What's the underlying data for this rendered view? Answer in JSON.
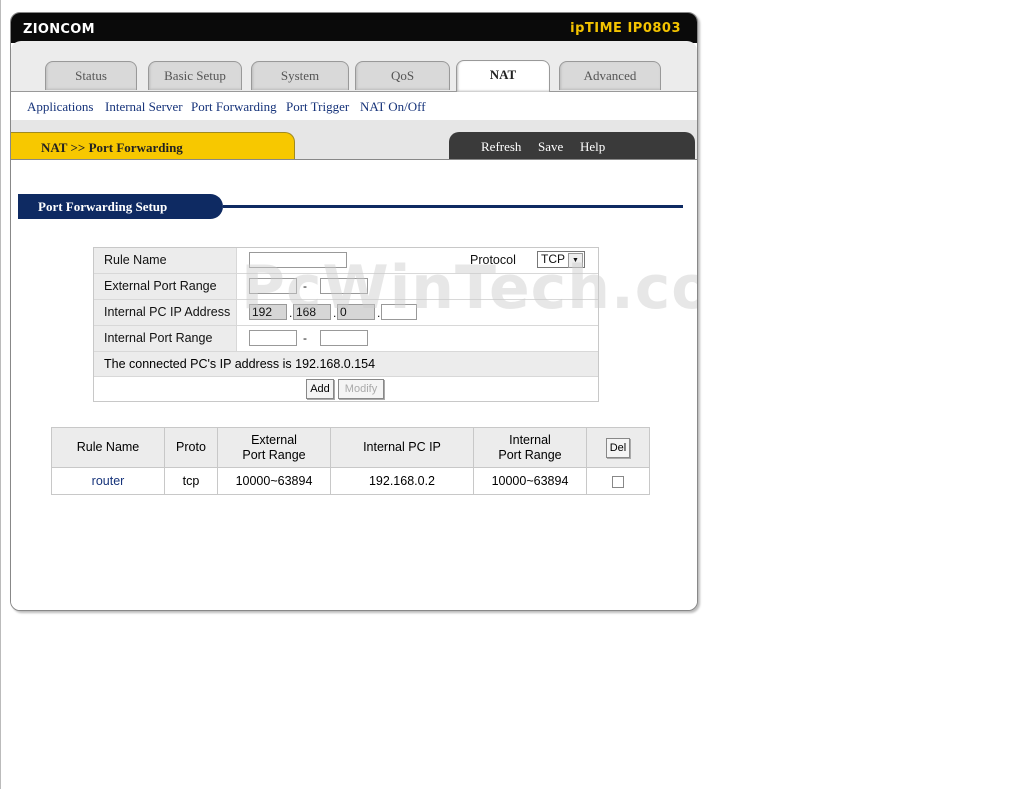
{
  "header": {
    "brand": "ZIONCOM",
    "model": "ipTIME IP0803"
  },
  "tabs": [
    {
      "label": "Status"
    },
    {
      "label": "Basic Setup"
    },
    {
      "label": "System"
    },
    {
      "label": "QoS"
    },
    {
      "label": "NAT",
      "active": true
    },
    {
      "label": "Advanced"
    }
  ],
  "subnav": [
    "Applications",
    "Internal Server",
    "Port Forwarding",
    "Port Trigger",
    "NAT On/Off"
  ],
  "breadcrumb": "NAT >> Port Forwarding",
  "actions": {
    "refresh": "Refresh",
    "save": "Save",
    "help": "Help"
  },
  "section_title": "Port Forwarding Setup",
  "form": {
    "rule_name_label": "Rule Name",
    "rule_name_value": "",
    "protocol_label": "Protocol",
    "protocol_value": "TCP",
    "external_port_label": "External Port Range",
    "external_port_from": "",
    "external_port_to": "",
    "internal_ip_label": "Internal PC IP Address",
    "ip_octets": [
      "192",
      "168",
      "0",
      ""
    ],
    "internal_port_label": "Internal Port Range",
    "internal_port_from": "",
    "internal_port_to": "",
    "range_separator": "-",
    "ip_separator": ".",
    "connected_ip_text": "The connected PC's IP address is 192.168.0.154",
    "add_label": "Add",
    "modify_label": "Modify"
  },
  "table": {
    "headers": {
      "rule_name": "Rule Name",
      "proto": "Proto",
      "ext_line1": "External",
      "ext_line2": "Port Range",
      "internal_ip": "Internal PC IP",
      "int_line1": "Internal",
      "int_line2": "Port Range",
      "del": "Del"
    },
    "rows": [
      {
        "rule_name": "router",
        "proto": "tcp",
        "external": "10000~63894",
        "internal_ip": "192.168.0.2",
        "internal": "10000~63894",
        "selected": false
      }
    ]
  },
  "watermark": "PcWinTech.com",
  "colors": {
    "accent_yellow": "#f7c800",
    "navy": "#0e2a62",
    "link_blue": "#16337a"
  }
}
